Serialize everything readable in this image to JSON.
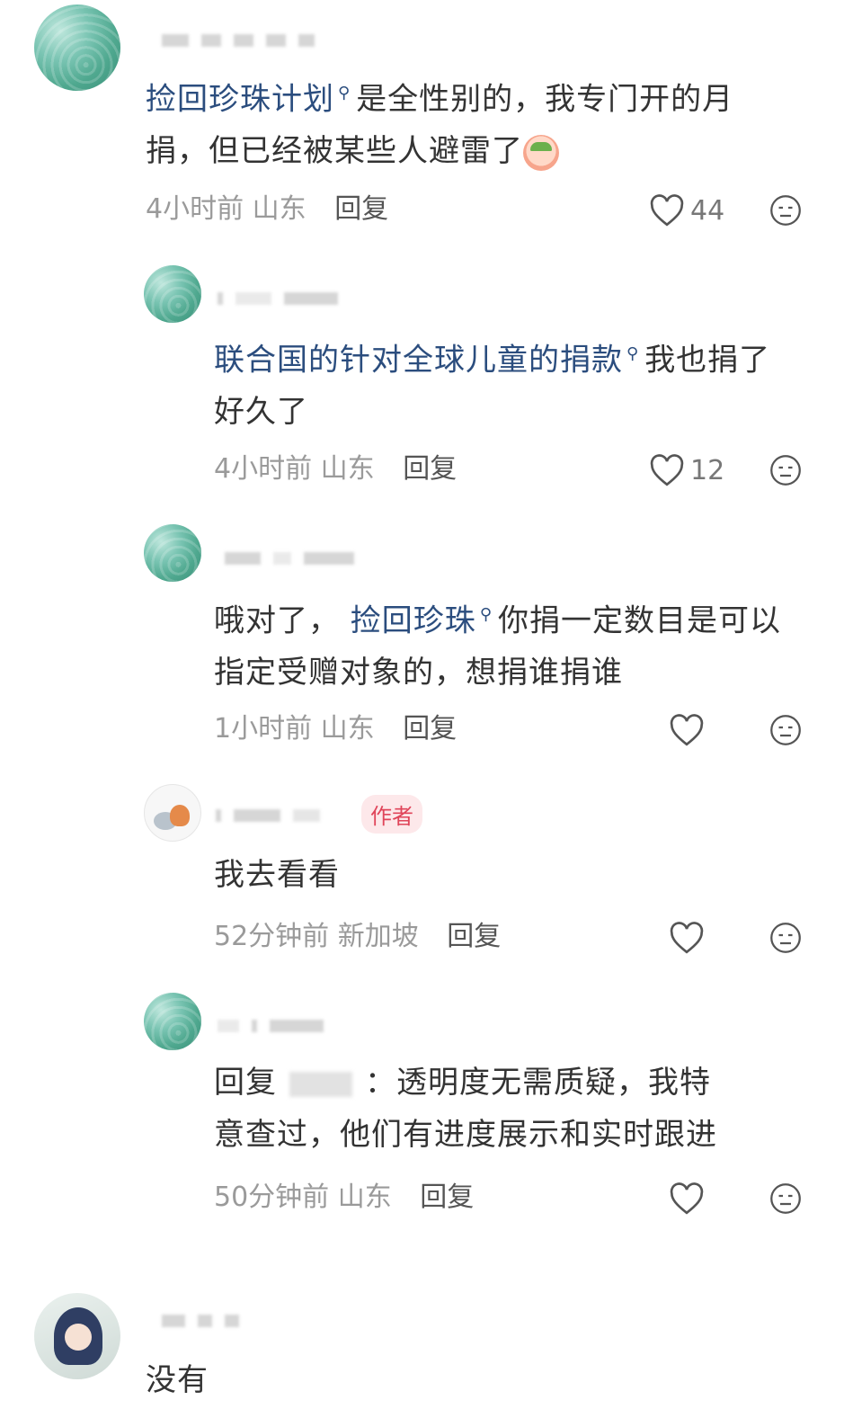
{
  "comments": [
    {
      "text_parts": [
        "捡回珍珠计划",
        "是全性别的，我专门开的月",
        "捐，但已经被某些人避雷了"
      ],
      "time": "4小时前",
      "location": "山东",
      "reply_label": "回复",
      "likes": "44"
    },
    {
      "text_parts": [
        "联合国的针对全球儿童的捐款",
        "我也捐了",
        "好久了"
      ],
      "time": "4小时前",
      "location": "山东",
      "reply_label": "回复",
      "likes": "12"
    },
    {
      "text_parts": [
        "哦对了，",
        "捡回珍珠",
        "你捐一定数目是可以",
        "指定受赠对象的，想捐谁捐谁"
      ],
      "time": "1小时前",
      "location": "山东",
      "reply_label": "回复"
    },
    {
      "badge": "作者",
      "text": "我去看看",
      "time": "52分钟前",
      "location": "新加坡",
      "reply_label": "回复"
    },
    {
      "text_parts": [
        "回复",
        "：透明度无需质疑，我特",
        "意查过，他们有进度展示和实时跟进"
      ],
      "time": "50分钟前",
      "location": "山东",
      "reply_label": "回复"
    },
    {
      "text": "没有"
    }
  ],
  "colors": {
    "link": "#2b4d7e",
    "meta": "#9a9a9a",
    "badge_text": "#e0455a",
    "badge_bg": "#fde8ea"
  },
  "icons": [
    "search-icon",
    "heart-icon",
    "dislike-face-icon",
    "crying-emoji"
  ]
}
